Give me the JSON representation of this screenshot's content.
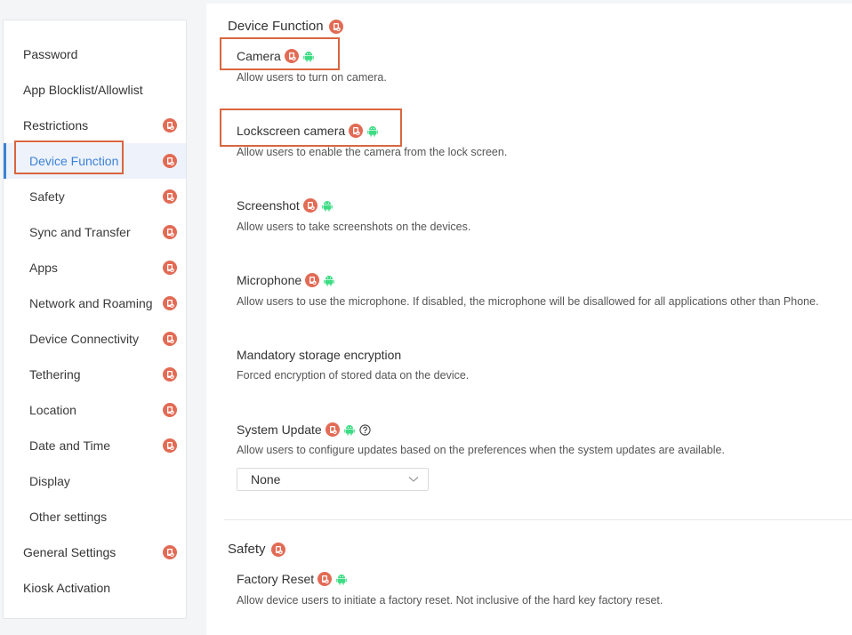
{
  "sidebar": {
    "items": [
      {
        "label": "Password",
        "level": 1,
        "lock": false,
        "active": false
      },
      {
        "label": "App Blocklist/Allowlist",
        "level": 1,
        "lock": false,
        "active": false
      },
      {
        "label": "Restrictions",
        "level": 1,
        "lock": true,
        "active": false
      },
      {
        "label": "Device Function",
        "level": 2,
        "lock": true,
        "active": true
      },
      {
        "label": "Safety",
        "level": 2,
        "lock": true,
        "active": false
      },
      {
        "label": "Sync and Transfer",
        "level": 2,
        "lock": true,
        "active": false
      },
      {
        "label": "Apps",
        "level": 2,
        "lock": true,
        "active": false
      },
      {
        "label": "Network and Roaming",
        "level": 2,
        "lock": true,
        "active": false
      },
      {
        "label": "Device Connectivity",
        "level": 2,
        "lock": true,
        "active": false
      },
      {
        "label": "Tethering",
        "level": 2,
        "lock": true,
        "active": false
      },
      {
        "label": "Location",
        "level": 2,
        "lock": true,
        "active": false
      },
      {
        "label": "Date and Time",
        "level": 2,
        "lock": true,
        "active": false
      },
      {
        "label": "Display",
        "level": 2,
        "lock": false,
        "active": false
      },
      {
        "label": "Other settings",
        "level": 2,
        "lock": false,
        "active": false
      },
      {
        "label": "General Settings",
        "level": 1,
        "lock": true,
        "active": false
      },
      {
        "label": "Kiosk Activation",
        "level": 1,
        "lock": false,
        "active": false
      }
    ]
  },
  "main": {
    "device_function": {
      "title": "Device Function",
      "items": [
        {
          "title": "Camera",
          "desc": "Allow users to turn on camera.",
          "icons": [
            "lock-icon",
            "android-icon"
          ]
        },
        {
          "title": "Lockscreen camera",
          "desc": "Allow users to enable the camera from the lock screen.",
          "icons": [
            "lock-icon",
            "android-icon"
          ]
        },
        {
          "title": "Screenshot",
          "desc": "Allow users to take screenshots on the devices.",
          "icons": [
            "lock-icon",
            "android-icon"
          ]
        },
        {
          "title": "Microphone",
          "desc": "Allow users to use the microphone. If disabled, the microphone will be disallowed for all applications other than Phone.",
          "icons": [
            "lock-icon",
            "android-icon"
          ]
        },
        {
          "title": "Mandatory storage encryption",
          "desc": "Forced encryption of stored data on the device.",
          "icons": []
        },
        {
          "title": "System Update",
          "desc": "Allow users to configure updates based on the preferences when the system updates are available.",
          "icons": [
            "lock-icon",
            "android-icon",
            "help-icon"
          ]
        }
      ],
      "system_update_select": "None"
    },
    "safety": {
      "title": "Safety",
      "items": [
        {
          "title": "Factory Reset",
          "desc": "Allow device users to initiate a factory reset. Not inclusive of the hard key factory reset.",
          "icons": [
            "lock-icon",
            "android-icon"
          ]
        }
      ]
    }
  },
  "colors": {
    "accent": "#3b82d6",
    "lock": "#e26b55",
    "android": "#3ddc84",
    "highlight": "#d9663f"
  }
}
